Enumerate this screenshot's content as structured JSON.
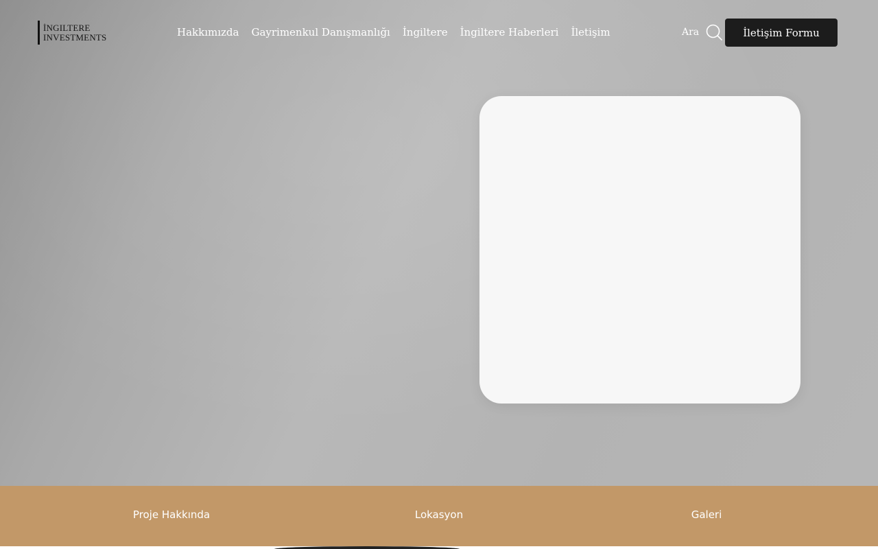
{
  "header": {
    "logo_line1": "İNGILTERE",
    "logo_line2": "INVESTMENTS",
    "nav": [
      {
        "label": "Hakkımızda"
      },
      {
        "label": "Gayrimenkul Danışmanlığı"
      },
      {
        "label": "İngiltere"
      },
      {
        "label": "İngiltere Haberleri"
      },
      {
        "label": "İletişim"
      }
    ],
    "search_label": "Ara",
    "search_icon": "search-icon",
    "cta_label": "İletişim Formu"
  },
  "tabs": [
    {
      "label": "Proje Hakkında"
    },
    {
      "label": "Lokasyon"
    },
    {
      "label": "Galeri"
    }
  ],
  "colors": {
    "tabbar": "#c29868",
    "cta": "#1c1c1c",
    "card": "#f7f7f7"
  }
}
